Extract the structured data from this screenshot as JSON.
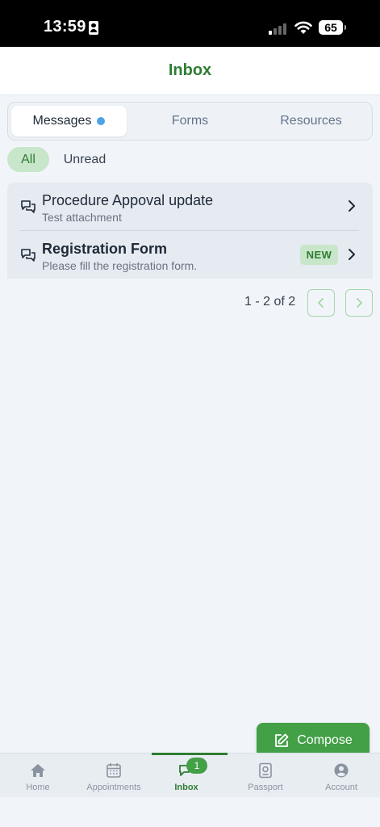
{
  "status_bar": {
    "time": "13:59",
    "battery": "65"
  },
  "header": {
    "title": "Inbox"
  },
  "tabs": [
    {
      "label": "Messages",
      "active": true,
      "has_dot": true
    },
    {
      "label": "Forms",
      "active": false
    },
    {
      "label": "Resources",
      "active": false
    }
  ],
  "filters": [
    {
      "label": "All",
      "active": true
    },
    {
      "label": "Unread",
      "active": false
    }
  ],
  "messages": [
    {
      "title": "Procedure Appoval update",
      "subtitle": "Test attachment",
      "unread": false,
      "icon": "chat-bubbles-icon"
    },
    {
      "title": "Registration Form",
      "subtitle": "Please fill the registration form.",
      "unread": true,
      "badge": "NEW",
      "icon": "chat-bubbles-icon"
    }
  ],
  "pagination": {
    "info": "1 - 2 of 2"
  },
  "compose": {
    "label": "Compose",
    "icon": "edit-icon"
  },
  "bottom_nav": {
    "items": [
      {
        "label": "Home",
        "icon": "home-icon"
      },
      {
        "label": "Appointments",
        "icon": "calendar-icon"
      },
      {
        "label": "Inbox",
        "icon": "chat-icon",
        "active": true,
        "badge": "1"
      },
      {
        "label": "Passport",
        "icon": "passport-icon"
      },
      {
        "label": "Account",
        "icon": "account-icon"
      }
    ]
  },
  "colors": {
    "brand_green": "#2e7d32",
    "button_green": "#43a047",
    "chip_green": "#c8e6c9",
    "dot_blue": "#4da3e6"
  }
}
